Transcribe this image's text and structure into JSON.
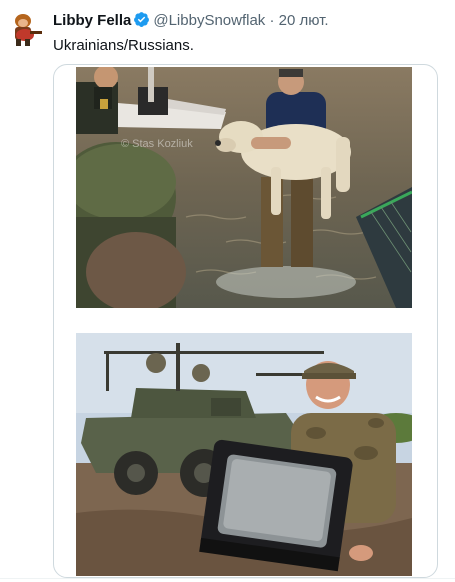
{
  "tweet": {
    "display_name": "Libby Fella",
    "handle": "@LibbySnowflak",
    "separator": "·",
    "timestamp": "20 лют.",
    "text": "Ukrainians/Russians.",
    "verified": true
  },
  "media": {
    "top_photo_watermark": "© Stas Kozliuk"
  },
  "colors": {
    "verified_badge": "#1d9bf0",
    "secondary_text": "#536471",
    "border": "#cfd9de"
  },
  "icons": [
    "avatar-image",
    "verified-badge-icon"
  ]
}
